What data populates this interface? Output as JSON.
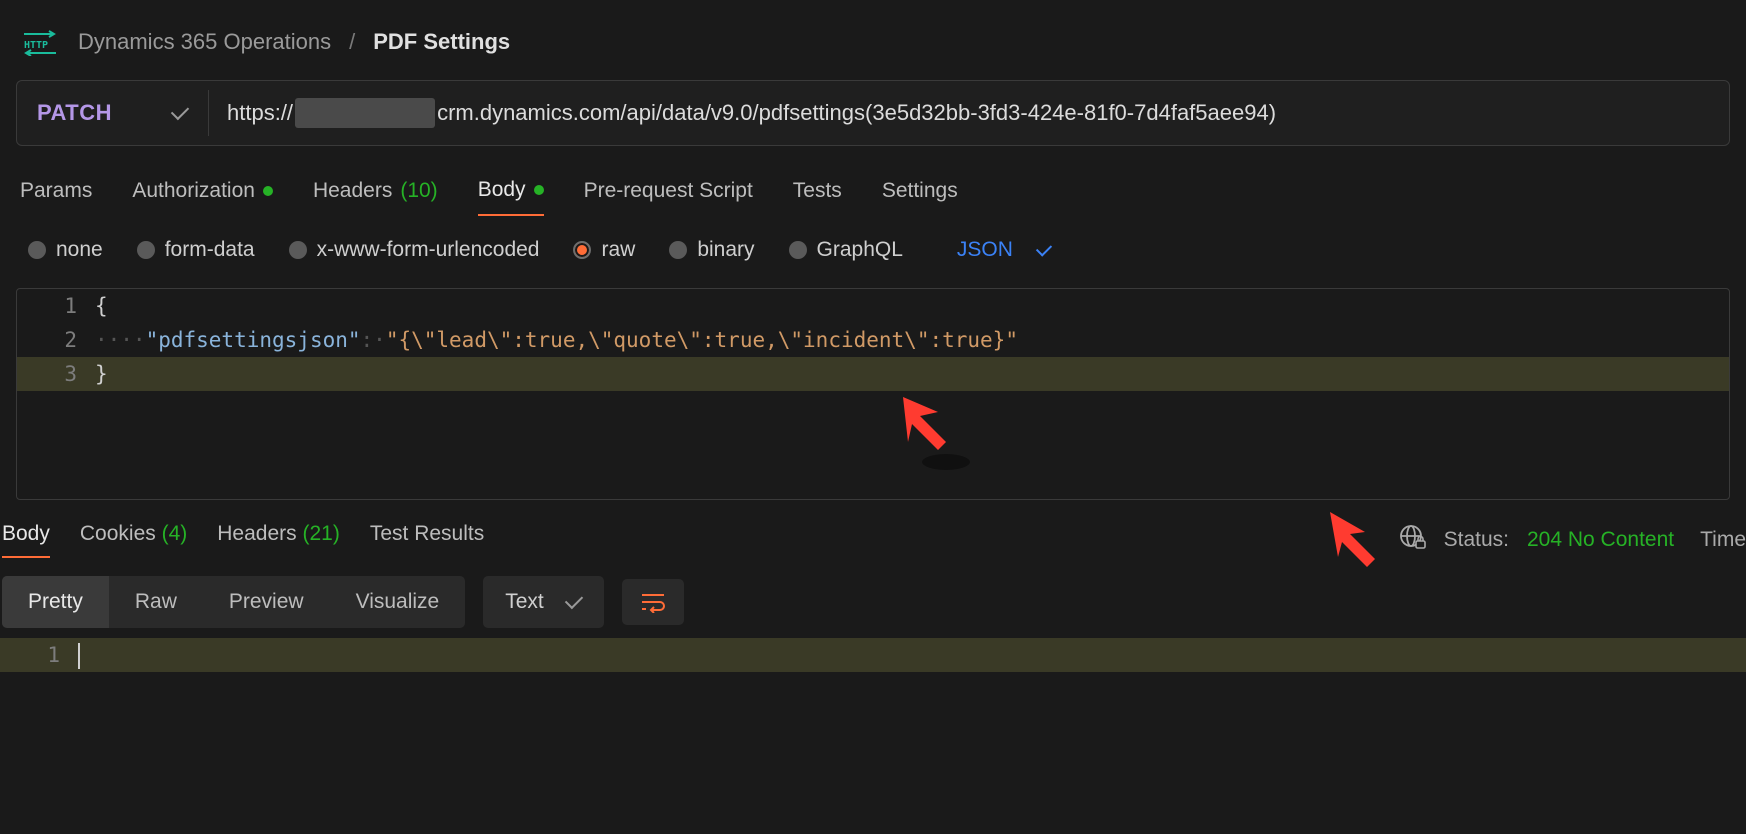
{
  "breadcrumb": {
    "parent": "Dynamics 365 Operations",
    "current": "PDF Settings"
  },
  "request": {
    "method": "PATCH",
    "url_prefix": "https://",
    "url_suffix": "crm.dynamics.com/api/data/v9.0/pdfsettings(3e5d32bb-3fd3-424e-81f0-7d4faf5aee94)"
  },
  "request_tabs": {
    "params": "Params",
    "authorization": "Authorization",
    "headers_label": "Headers",
    "headers_count": "(10)",
    "body": "Body",
    "prerequest": "Pre-request Script",
    "tests": "Tests",
    "settings": "Settings"
  },
  "body_types": {
    "none": "none",
    "form_data": "form-data",
    "urlencoded": "x-www-form-urlencoded",
    "raw": "raw",
    "binary": "binary",
    "graphql": "GraphQL",
    "format": "JSON"
  },
  "code": {
    "l1_num": "1",
    "l1_text": "{",
    "l2_num": "2",
    "l2_indent": "····",
    "l2_key": "\"pdfsettingsjson\"",
    "l2_colon": ":·",
    "l2_val": "\"{\\\"lead\\\":true,\\\"quote\\\":true,\\\"incident\\\":true}\"",
    "l3_num": "3",
    "l3_text": "}"
  },
  "response_tabs": {
    "body": "Body",
    "cookies_label": "Cookies",
    "cookies_count": "(4)",
    "headers_label": "Headers",
    "headers_count": "(21)",
    "test_results": "Test Results"
  },
  "status": {
    "label": "Status:",
    "value": "204 No Content",
    "time_label": "Time"
  },
  "view_modes": {
    "pretty": "Pretty",
    "raw": "Raw",
    "preview": "Preview",
    "visualize": "Visualize",
    "text": "Text"
  },
  "response_code": {
    "l1_num": "1"
  }
}
